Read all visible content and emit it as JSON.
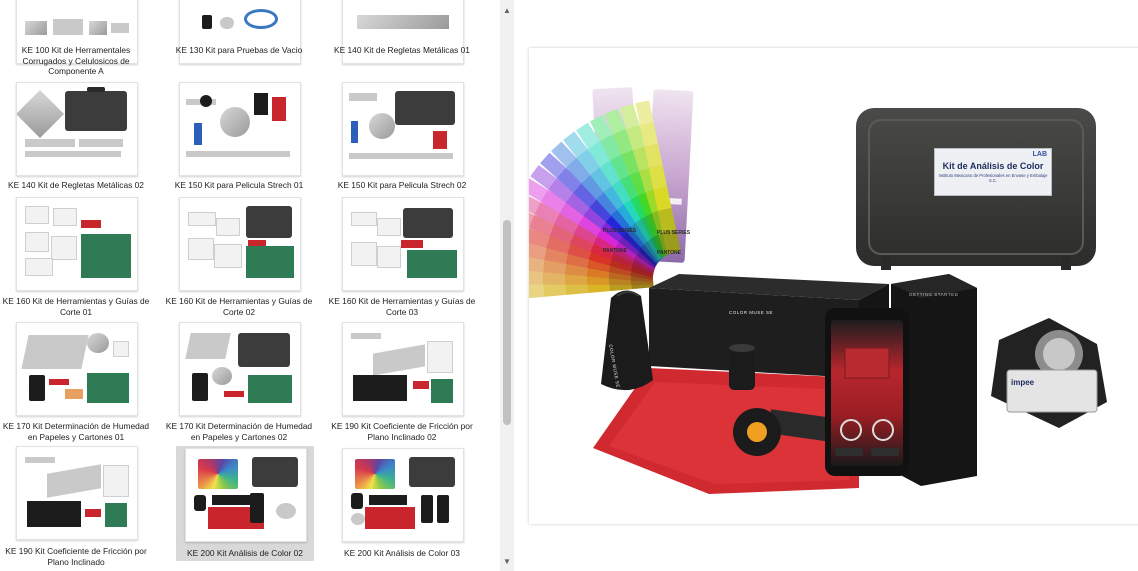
{
  "tiles": [
    {
      "caption": "KE 100 Kit de Herramentales Corrugados y Celulosicos de Componente A",
      "selected": false
    },
    {
      "caption": "KE 130 Kit para Pruebas de Vacio",
      "selected": false
    },
    {
      "caption": "KE 140 Kit de Regletas Metálicas 01",
      "selected": false
    },
    {
      "caption": "KE 140 Kit de Regletas Metálicas 02",
      "selected": false
    },
    {
      "caption": "KE 150 Kit para Pelicula Strech 01",
      "selected": false
    },
    {
      "caption": "KE 150 Kit para Pelicula Strech 02",
      "selected": false
    },
    {
      "caption": "KE 160 Kit de Herramientas y Guías de Corte 01",
      "selected": false
    },
    {
      "caption": "KE 160 Kit de Herramientas y Guías de Corte 02",
      "selected": false
    },
    {
      "caption": "KE 160 Kit de Herramientas y Guías de Corte 03",
      "selected": false
    },
    {
      "caption": "KE 170 Kit Determinación de Humedad en Papeles y Cartones 01",
      "selected": false
    },
    {
      "caption": "KE 170 Kit Determinación de Humedad en Papeles y Cartones 02",
      "selected": false
    },
    {
      "caption": "KE 190 Kit Coeficiente de Fricción por Plano Inclinado 02",
      "selected": false
    },
    {
      "caption": "KE 190 Kit Coeficiente de Fricción por Plano Inclinado",
      "selected": false
    },
    {
      "caption": "KE 200 Kit Análisis de Color 02",
      "selected": true
    },
    {
      "caption": "KE 200 Kit Análisis de Color 03",
      "selected": false
    }
  ],
  "preview": {
    "case_label_title": "Kit de Análisis de Color",
    "case_label_sub": "Instituto Mexicano de Profesionales en Envase y Embalaje S.C.",
    "case_label_brand": "LAB",
    "pantone_brand": "PANTONE",
    "pantone_series": "PLUS SERIES",
    "colormuse_text": "COLOR MUSE SE",
    "getting_started": "GETTING STARTED",
    "loupe_brand": "impee"
  },
  "icons": {
    "scroll_up": "chevron-up-icon",
    "scroll_down": "chevron-down-icon"
  },
  "colors": {
    "selected_tile": "#d9d9d9",
    "scrollbar_track": "#f1f1f1",
    "scrollbar_thumb": "#c1c1c1"
  }
}
